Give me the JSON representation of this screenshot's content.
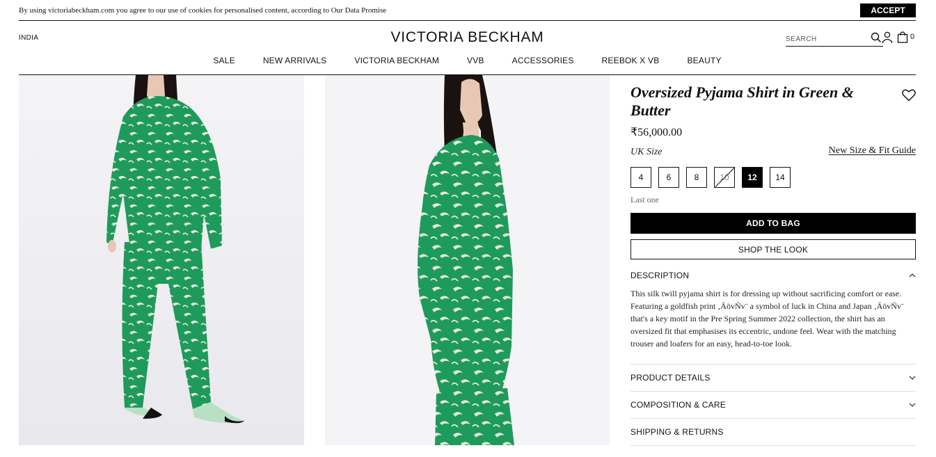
{
  "cookie_bar": {
    "text": "By using victoriabeckham.com you agree to our use of cookies for personalised content, according to Our Data Promise",
    "accept_label": "ACCEPT"
  },
  "header": {
    "country": "INDIA",
    "logo": "VICTORIA BECKHAM",
    "search_placeholder": "SEARCH",
    "bag_count": "0"
  },
  "nav": [
    "SALE",
    "NEW ARRIVALS",
    "VICTORIA BECKHAM",
    "VVB",
    "ACCESSORIES",
    "REEBOK X VB",
    "BEAUTY"
  ],
  "images": [
    {
      "icon": "product-photo-front",
      "alt": ""
    },
    {
      "icon": "product-photo-side",
      "alt": ""
    }
  ],
  "product": {
    "title": "Oversized Pyjama Shirt in Green & Butter",
    "price": "₹56,000.00",
    "size_label": "UK Size",
    "fit_guide": "New Size & Fit Guide",
    "sizes": [
      {
        "label": "4",
        "state": "available"
      },
      {
        "label": "6",
        "state": "available"
      },
      {
        "label": "8",
        "state": "available"
      },
      {
        "label": "10",
        "state": "unavailable"
      },
      {
        "label": "12",
        "state": "selected"
      },
      {
        "label": "14",
        "state": "available"
      }
    ],
    "stock_note": "Last one",
    "add_to_bag": "ADD TO BAG",
    "shop_the_look": "SHOP THE LOOK"
  },
  "accordion": {
    "description_title": "DESCRIPTION",
    "description_text": "This silk twill pyjama shirt is for dressing up without sacrificing comfort or ease. Featuring a goldfish print ‚ÄövÑv¨ a symbol of luck in China and Japan ‚ÄövÑv¨ that's a key motif in the Pre Spring Summer 2022 collection, the shirt has an oversized fit that emphasises its eccentric, undone feel. Wear with the matching trouser and loafers for an easy, head-to-toe look.",
    "product_details": "PRODUCT DETAILS",
    "composition": "COMPOSITION & CARE",
    "shipping": "SHIPPING & RETURNS"
  },
  "colors": {
    "garment_green": "#1e9a5c",
    "print_cream": "#e6ecd8",
    "hair": "#1a1210",
    "skin": "#e8c8b4",
    "backdrop": "#f3f2f4"
  }
}
